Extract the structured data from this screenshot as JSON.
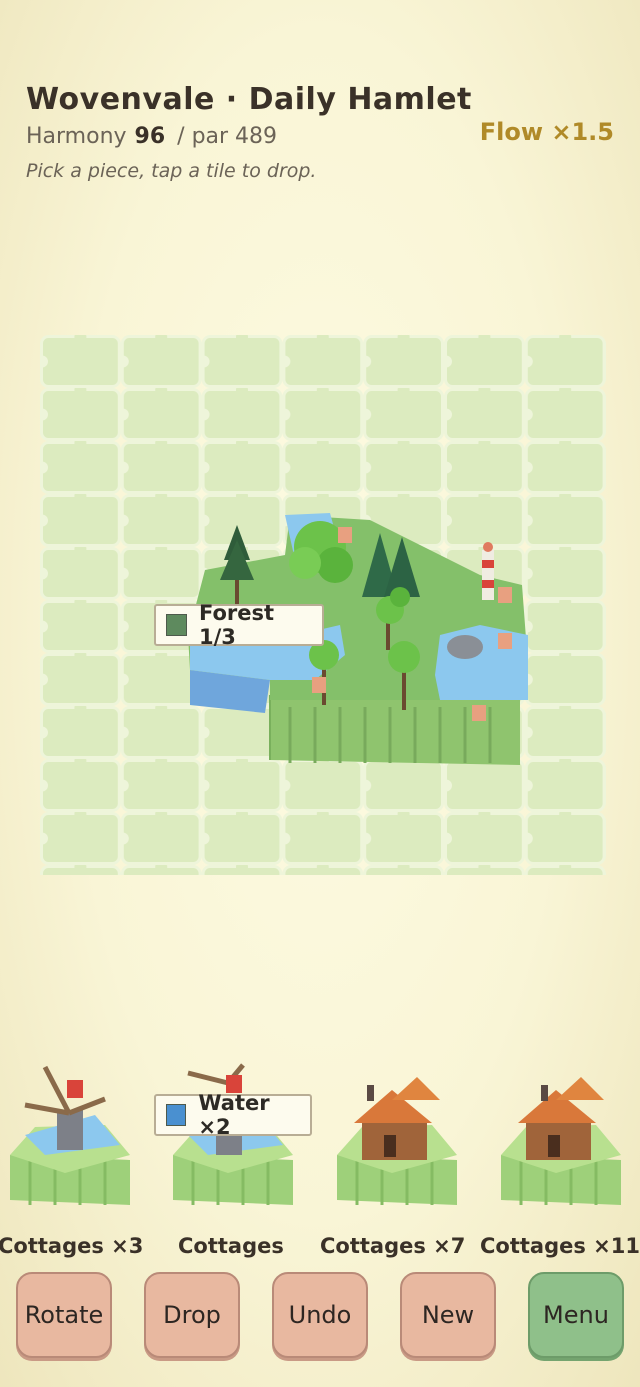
{
  "header": {
    "title": "Wovenvale · Daily Hamlet",
    "score_label": "Harmony",
    "score_value": "96",
    "par": "/ par 489",
    "hint": "Pick a piece, tap a tile to drop.",
    "flow": "Flow ×1.5"
  },
  "board": {
    "callout_forest": {
      "label": "Forest 1/3",
      "color": "#5e8a5e"
    }
  },
  "tray": {
    "callout_water": {
      "label": "Water ×2",
      "color": "#4a90d0"
    },
    "pieces": [
      {
        "name": "windmill",
        "label": "Cottages  ×3"
      },
      {
        "name": "windmill",
        "label": "Cottages"
      },
      {
        "name": "cottage",
        "label": "Cottages  ×7"
      },
      {
        "name": "cottage",
        "label": "Cottages  ×11"
      }
    ]
  },
  "buttons": {
    "rotate": "Rotate",
    "drop": "Drop",
    "undo": "Undo",
    "new": "New",
    "menu": "Menu"
  },
  "colors": {
    "grass": "#84c06a",
    "grass_side": "#9ed07a",
    "water": "#8cc8ee",
    "empty_tile": "#dcebbf",
    "button": "#e8b8a0",
    "menu_button": "#8fc08a",
    "flow": "#b08a28"
  }
}
